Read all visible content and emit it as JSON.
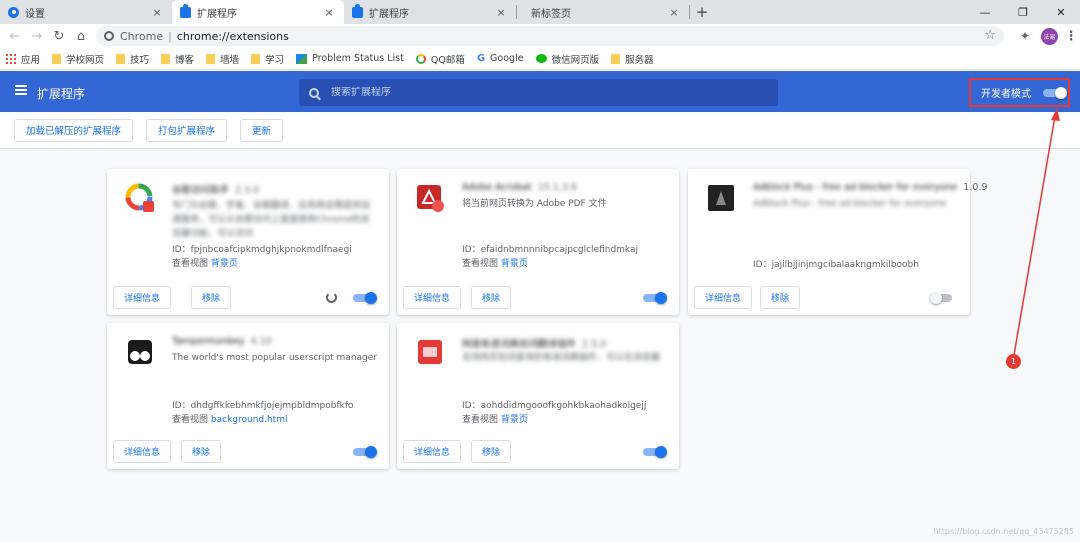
{
  "tabs": [
    {
      "title": "设置",
      "icon": "gear-icon",
      "active": false
    },
    {
      "title": "扩展程序",
      "icon": "puzzle-icon",
      "active": true
    },
    {
      "title": "扩展程序",
      "icon": "puzzle-icon",
      "active": false
    },
    {
      "title": "新标签页",
      "icon": "",
      "active": false
    }
  ],
  "tab_close": "×",
  "new_tab": "+",
  "window": {
    "minimize": "—",
    "restore": "❐",
    "close": "✕"
  },
  "omnibox": {
    "scheme": "Chrome",
    "separator": "|",
    "url": "chrome://extensions"
  },
  "avatar_text": "法易",
  "bookmarks": [
    {
      "label": "应用",
      "icon": "apps"
    },
    {
      "label": "学校网页",
      "icon": "folder"
    },
    {
      "label": "技巧",
      "icon": "folder"
    },
    {
      "label": "博客",
      "icon": "folder"
    },
    {
      "label": "墙墙",
      "icon": "folder"
    },
    {
      "label": "学习",
      "icon": "folder"
    },
    {
      "label": "Problem Status List",
      "icon": "ps"
    },
    {
      "label": "QQ邮箱",
      "icon": "qq"
    },
    {
      "label": "Google",
      "icon": "google"
    },
    {
      "label": "微信网页版",
      "icon": "wechat"
    },
    {
      "label": "服务器",
      "icon": "folder"
    }
  ],
  "header": {
    "title": "扩展程序",
    "search_placeholder": "搜索扩展程序",
    "dev_mode_label": "开发者模式",
    "dev_mode_on": true
  },
  "actions": {
    "load_unpacked": "加载已解压的扩展程序",
    "pack": "打包扩展程序",
    "update": "更新"
  },
  "card_labels": {
    "details": "详细信息",
    "remove": "移除",
    "id_prefix": "ID：",
    "views_prefix": "查看视图"
  },
  "extensions": [
    {
      "name": "谷歌访问助手",
      "version": "2.3.0",
      "description": "专门为谷歌、学者、谷歌翻译、应用商店等提供加速服务，可以从谷歌访问上直接使用Chrome的浏览器功能，可以访问",
      "id": "fpjnbcoafcipkmdghjkpnokmdlfnaegi",
      "view": "背景页",
      "enabled": true,
      "has_reload": true,
      "icon_color": "#e94235"
    },
    {
      "name": "Adobe Acrobat",
      "version": "15.1.3.6",
      "description": "将当前网页转换为 Adobe PDF 文件",
      "id": "efaidnbmnnnibpcajpcglclefindmkaj",
      "view": "背景页",
      "enabled": true,
      "has_reload": false,
      "icon_color": "#c62828"
    },
    {
      "name": "Adblock Plus - free ad blocker for everyone",
      "version": "1.0.9",
      "description": "Adblock Plus - free ad blocker for everyone",
      "id": "jajilbjjinjmgcibalaakngmkilboobh",
      "view": "",
      "enabled": false,
      "has_reload": false,
      "icon_color": "#333333"
    },
    {
      "name": "Tampermonkey",
      "version": "4.10",
      "description": "The world's most popular userscript manager",
      "id": "dhdgffkkebhmkfjojejmpbldmpobfkfo",
      "view": "background.html",
      "enabled": true,
      "has_reload": false,
      "icon_color": "#222222"
    },
    {
      "name": "网易有道词典划词翻译插件",
      "version": "2.5.0",
      "description": "支持网页划词查询的有道词典插件，可以在浏览器中实现鼠标取词",
      "id": "aohddidmgooofkgohkbkaohadkolgejj",
      "view": "背景页",
      "enabled": true,
      "has_reload": false,
      "icon_color": "#e53935"
    }
  ],
  "annotation": {
    "marker": "1"
  },
  "watermark": "https://blog.csdn.net/qq_43475285",
  "colors": {
    "accent": "#1a73e8",
    "header": "#3367d6",
    "highlight": "#e53935"
  }
}
